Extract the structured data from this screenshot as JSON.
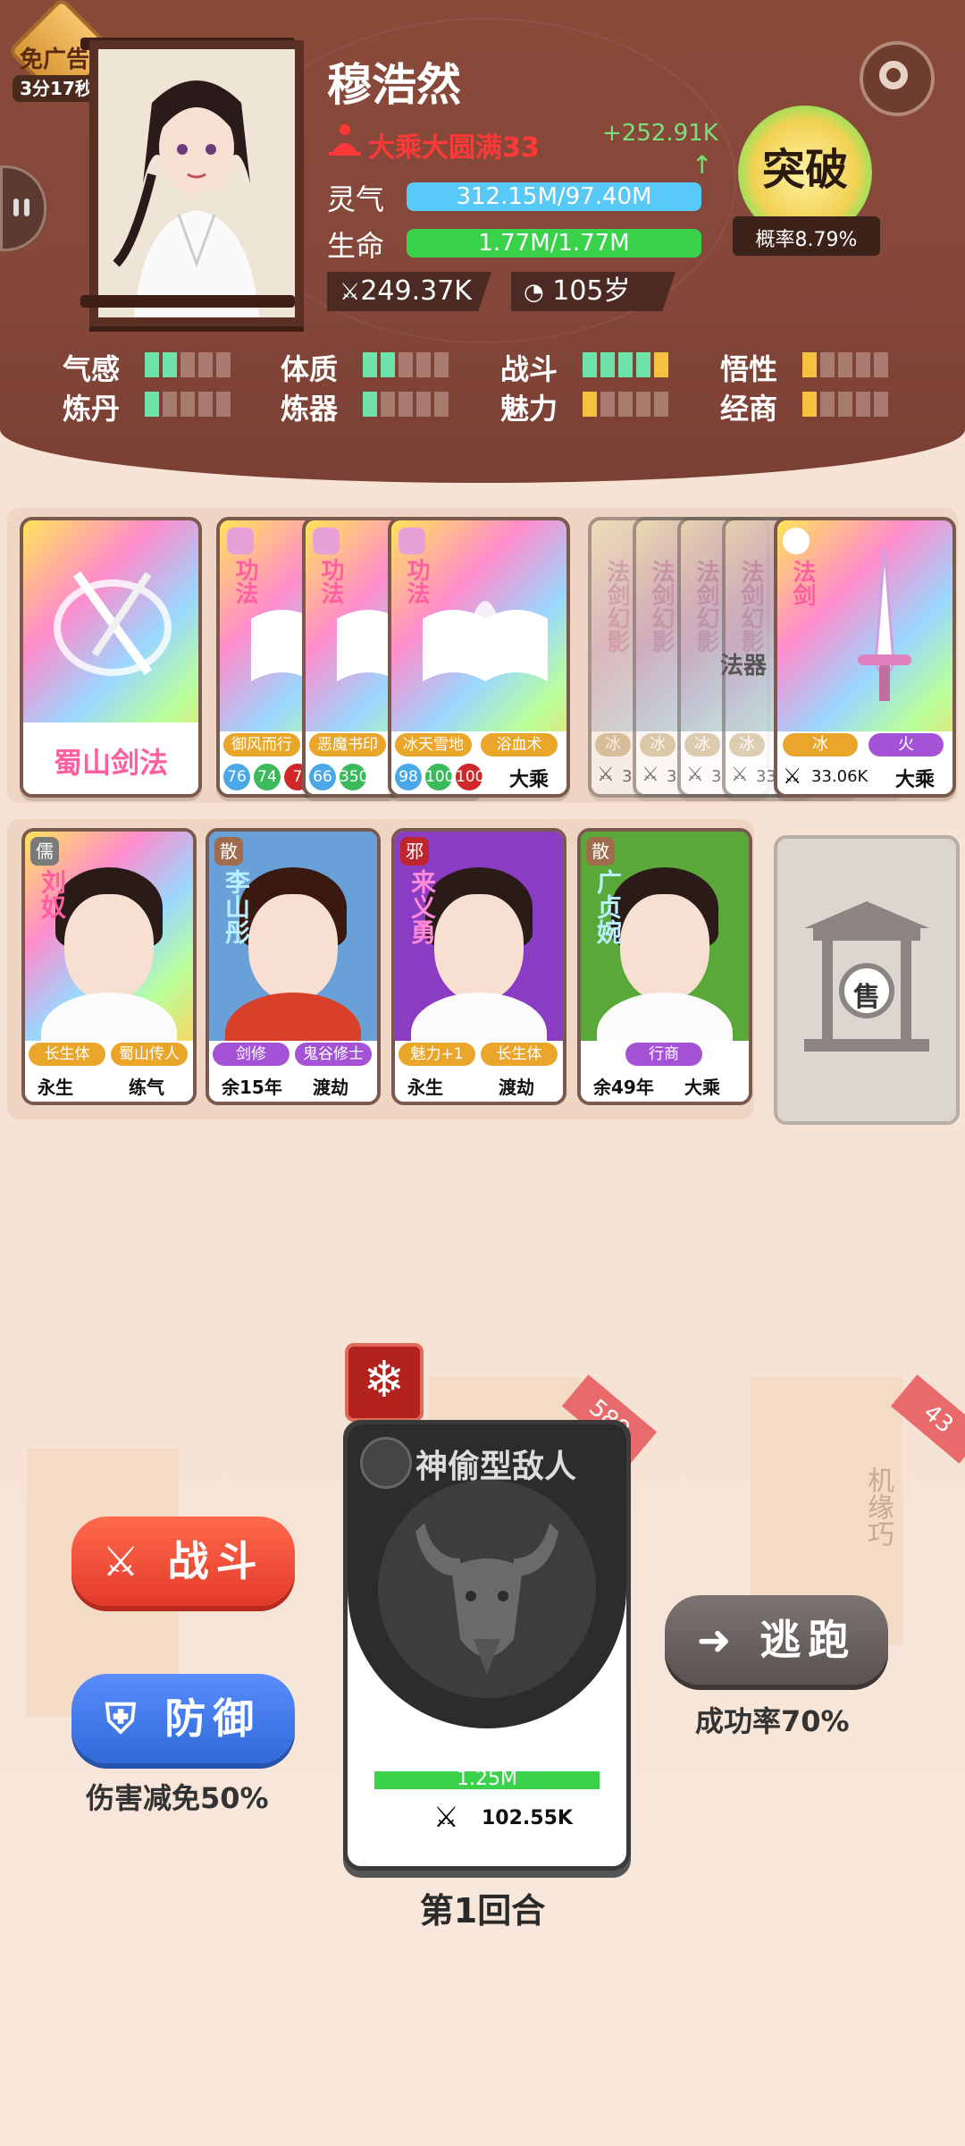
{
  "header": {
    "ad_badge": {
      "label": "免广告",
      "timer": "3分17秒"
    },
    "character": {
      "name": "穆浩然",
      "realm": "大乘大圆满33",
      "gain": "+252.91K",
      "gain_arrow": "↑",
      "spirit_label": "灵气",
      "spirit_value": "312.15M/97.40M",
      "life_label": "生命",
      "life_value": "1.77M/1.77M",
      "power": "249.37K",
      "age": "105岁"
    },
    "breakthrough": {
      "label": "突破",
      "rate": "概率8.79%"
    },
    "attributes": [
      {
        "label": "气感",
        "level": 2,
        "color": "#6ee2a8"
      },
      {
        "label": "体质",
        "level": 2,
        "color": "#6ee2a8"
      },
      {
        "label": "战斗",
        "level": 5,
        "color": "#6ee2a8"
      },
      {
        "label": "悟性",
        "level": 1,
        "color": "#f6c13e"
      },
      {
        "label": "炼丹",
        "level": 1,
        "color": "#6ee2a8"
      },
      {
        "label": "炼器",
        "level": 1,
        "color": "#6ee2a8"
      },
      {
        "label": "魅力",
        "level": 1,
        "color": "#f6c13e"
      },
      {
        "label": "经商",
        "level": 1,
        "color": "#f6c13e"
      }
    ]
  },
  "skills": {
    "main": {
      "name": "蜀山剑法"
    },
    "gongfa": [
      {
        "type": "功法",
        "name": "御风而行",
        "nums": [
          "76",
          "74",
          "7"
        ]
      },
      {
        "type": "功法",
        "name": "恶魔书印",
        "nums": [
          "66",
          "350",
          ""
        ]
      },
      {
        "type": "功法",
        "name": "冰天雪地",
        "nums": [
          "98",
          "100",
          "100"
        ],
        "extra_name": "浴血术",
        "realm": "大乘"
      }
    ],
    "weapons_stack": [
      {
        "type": "法剑幻影",
        "tag": "冰",
        "value": "3"
      },
      {
        "type": "法剑幻影",
        "tag": "冰",
        "value": "3"
      },
      {
        "type": "法剑幻影",
        "tag": "冰",
        "value": "3"
      },
      {
        "type": "法剑幻影",
        "tag": "冰",
        "value": "33"
      }
    ],
    "weapon_stack_label": "法器",
    "weapon": {
      "type": "法剑",
      "tags": [
        "冰",
        "火"
      ],
      "power": "33.06K",
      "realm": "大乘"
    }
  },
  "companions": [
    {
      "badge": "儒",
      "badge_color": "#7a7a7a",
      "name": "刘奴",
      "tags": [
        "长生体",
        "蜀山传人"
      ],
      "life": "永生",
      "stage": "练气",
      "bg": "holo"
    },
    {
      "badge": "散",
      "badge_color": "#a06c4c",
      "name": "李山彤",
      "tags": [
        "剑修",
        "鬼谷修士"
      ],
      "life": "余15年",
      "stage": "渡劫",
      "bg": "#6aa0d8"
    },
    {
      "badge": "邪",
      "badge_color": "#c0242c",
      "name": "来义勇",
      "tags": [
        "魅力+1",
        "长生体"
      ],
      "life": "永生",
      "stage": "渡劫",
      "bg": "#8a3cc2"
    },
    {
      "badge": "散",
      "badge_color": "#a06c4c",
      "name": "广贞婉",
      "tags": [
        "行商"
      ],
      "life": "余49年",
      "stage": "大乘",
      "bg": "#5aa83a"
    }
  ],
  "sell": {
    "label": "售"
  },
  "battle": {
    "fight_label": "战斗",
    "defend_label": "防御",
    "defend_note": "伤害减免50%",
    "flee_label": "逃跑",
    "flee_note": "成功率70%",
    "enemy": {
      "name": "神偷型敌人",
      "hp": "1.25M",
      "hp_fraction": 1.0,
      "power": "102.55K"
    },
    "round": "第1回合",
    "bg_tags": [
      "589",
      "43"
    ],
    "bg_scroll_text": "机缘巧"
  },
  "colors": {
    "spirit": "#58c8f6",
    "life": "#3ad24a",
    "header": "#84473a"
  }
}
